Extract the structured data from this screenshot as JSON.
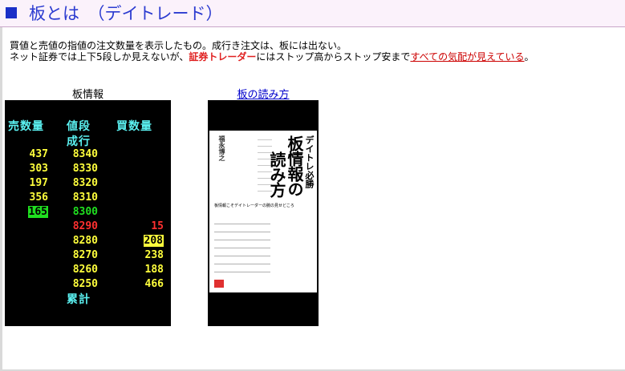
{
  "header": {
    "title": "板とは　（デイトレード）"
  },
  "description": {
    "line1": "買値と売値の指値の注文数量を表示したもの。成行き注文は、板には出ない。",
    "line2_pre": "ネット証券では上下5段しか見えないが、",
    "line2_bold": "証券トレーダー",
    "line2_mid": "にはストップ高からストップ安まで",
    "line2_link": "すべての気配が見えている",
    "line2_post": "。"
  },
  "board": {
    "label": "板情報",
    "headers": {
      "sell": "売数量",
      "price": "値段",
      "buy": "買数量",
      "market": "成行",
      "total": "累計"
    },
    "rows": [
      {
        "sell": "437",
        "price": "8340",
        "buy": ""
      },
      {
        "sell": "303",
        "price": "8330",
        "buy": ""
      },
      {
        "sell": "197",
        "price": "8320",
        "buy": ""
      },
      {
        "sell": "356",
        "price": "8310",
        "buy": ""
      },
      {
        "sell": "165",
        "price": "8300",
        "buy": ""
      },
      {
        "sell": "",
        "price": "8290",
        "buy": "15"
      },
      {
        "sell": "",
        "price": "8280",
        "buy": "208"
      },
      {
        "sell": "",
        "price": "8270",
        "buy": "238"
      },
      {
        "sell": "",
        "price": "8260",
        "buy": "188"
      },
      {
        "sell": "",
        "price": "8250",
        "buy": "466"
      }
    ]
  },
  "book": {
    "link": "板の読み方",
    "cover_kicker": "デイトレ必勝",
    "cover_main1": "板情報の",
    "cover_main2": "読み方",
    "cover_author": "福永博之",
    "cover_subtitle": "板情報こそデイトレーダーの腕の見せどころ"
  },
  "colors": {
    "title": "#2b3bd0",
    "board_bg": "#000000",
    "yellow": "#ffff3c",
    "green": "#20e020",
    "red": "#ff3030",
    "cyan": "#5bf1f1",
    "link": "#cc0000"
  }
}
